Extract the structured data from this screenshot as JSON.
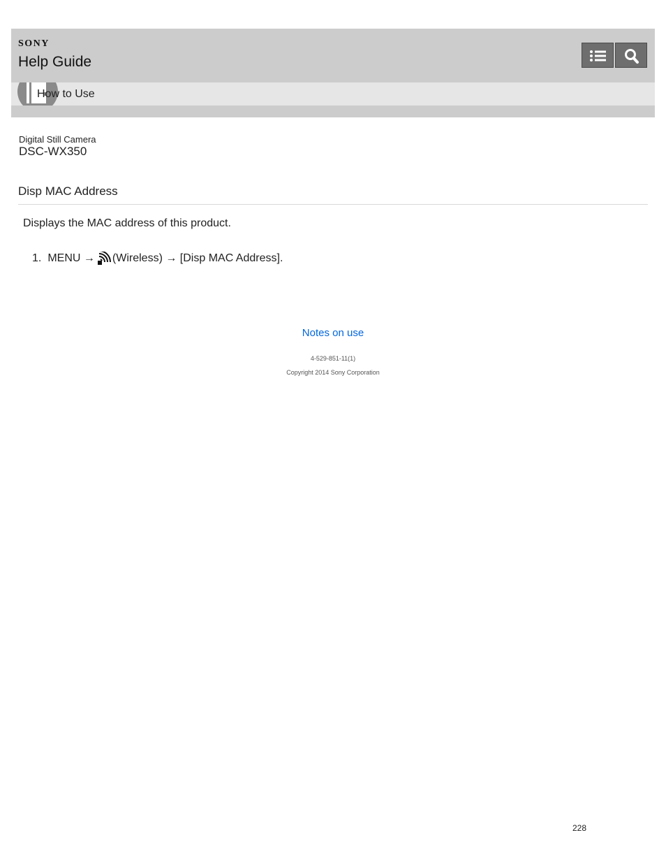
{
  "header": {
    "brand": "SONY",
    "title": "Help Guide",
    "toc_icon": "list-icon",
    "search_icon": "search-icon",
    "background": "#cccccc"
  },
  "breadcrumb": {
    "label": "How to Use",
    "icon": "book-icon"
  },
  "product": {
    "category": "Digital Still Camera",
    "model": "DSC-WX350"
  },
  "page": {
    "heading": "Disp MAC Address",
    "description": "Displays the MAC address of this product.",
    "steps": [
      {
        "number": "1.",
        "prefix": "MENU →",
        "icon": "wireless-icon",
        "suffix": "(Wireless) → [Disp MAC Address]."
      }
    ]
  },
  "footer": {
    "link": "Notes on use",
    "link_color": "#0066dd",
    "doc_number": "4-529-851-11(1)",
    "copyright": "Copyright 2014 Sony Corporation",
    "page_number": "228"
  }
}
